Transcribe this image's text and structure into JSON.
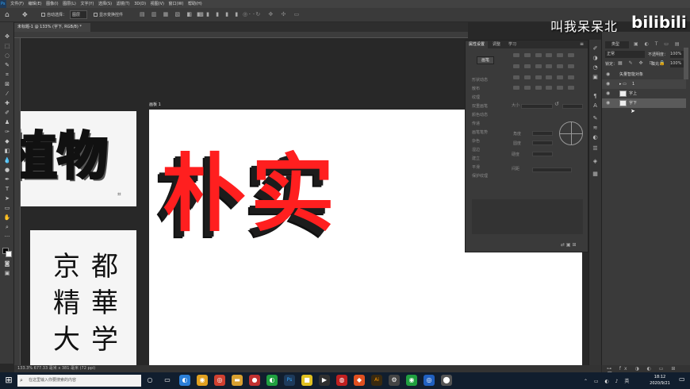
{
  "menu": {
    "ps_logo": "Ps",
    "items": [
      "文件(F)",
      "编辑(E)",
      "图像(I)",
      "图层(L)",
      "文字(Y)",
      "选择(S)",
      "滤镜(T)",
      "3D(D)",
      "视图(V)",
      "窗口(W)",
      "帮助(H)"
    ]
  },
  "options": {
    "auto_select": "自动选择：",
    "auto_select_value": "图层",
    "show_transform": "显示变换控件"
  },
  "document": {
    "tab_title": "未标题-1 @ 133% (字下, RGB/8) *",
    "artboard_name": "画板 1",
    "main_text": "朴实",
    "ref1_text": "植物",
    "ref2_chars": [
      "京",
      "都",
      "精",
      "華",
      "大",
      "学"
    ]
  },
  "properties": {
    "tabs": [
      "属性设置",
      "调整",
      "学习"
    ],
    "button": "画笔",
    "rows": [
      "形状动态",
      "散布",
      "纹理",
      "双重画笔",
      "颜色动态",
      "传递",
      "画笔笔势",
      "杂色",
      "湿边",
      "建立",
      "平滑",
      "保护纹理"
    ],
    "labels": {
      "size": "大小",
      "angle": "角度",
      "roundness": "圆度",
      "hardness": "硬度",
      "spacing": "间距"
    }
  },
  "layers": {
    "search_kind": "类型",
    "blend_mode": "正常",
    "opacity_label": "不透明度：",
    "opacity_value": "100%",
    "lock_label": "锁定：",
    "fill_label": "填充：",
    "fill_value": "100%",
    "items": [
      "矢量智能对象",
      "1",
      "字上",
      "字下"
    ]
  },
  "status": {
    "text": "133.3%    677.33 毫米 x 381 毫米 (72 ppi)"
  },
  "taskbar": {
    "search_placeholder": "在这里输入你要搜索的内容",
    "time": "18:12",
    "date": "2020/9/21"
  },
  "watermark": {
    "text": "叫我呆呆北",
    "logo": "bilibili"
  },
  "colors": {
    "accent_red": "#ff1f1f",
    "ps_panel": "#3a3a3a"
  }
}
